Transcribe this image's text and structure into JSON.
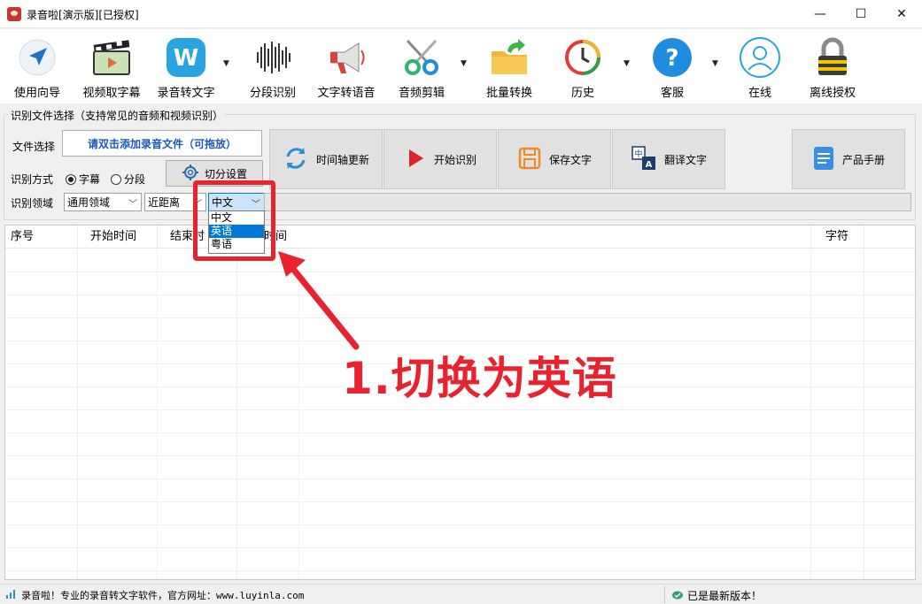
{
  "window": {
    "title": "录音啦[演示版][已授权]",
    "controls": {
      "minimize": "—",
      "maximize": "☐",
      "close": "✕"
    }
  },
  "toolbar": {
    "items": [
      {
        "label": "使用向导",
        "icon": "navigation-arrow-icon"
      },
      {
        "label": "视频取字幕",
        "icon": "video-clapper-icon"
      },
      {
        "label": "录音转文字",
        "icon": "w-app-icon",
        "has_dropdown": true
      },
      {
        "label": "分段识别",
        "icon": "sound-wave-icon"
      },
      {
        "label": "文字转语音",
        "icon": "megaphone-icon"
      },
      {
        "label": "音频剪辑",
        "icon": "scissors-icon",
        "has_dropdown": true
      },
      {
        "label": "批量转换",
        "icon": "folder-arrow-icon"
      },
      {
        "label": "历史",
        "icon": "history-clock-icon",
        "has_dropdown": true
      },
      {
        "label": "客服",
        "icon": "help-question-icon",
        "has_dropdown": true
      },
      {
        "label": "在线",
        "icon": "user-online-icon"
      },
      {
        "label": "离线授权",
        "icon": "lock-icon"
      }
    ]
  },
  "panel": {
    "group_title": "识别文件选择（支持常见的音频和视频识别）",
    "file_label": "文件选择",
    "add_file_button": "请双击添加录音文件（可拖放）",
    "mode_label": "识别方式",
    "mode_options": [
      {
        "label": "字幕",
        "checked": true
      },
      {
        "label": "分段",
        "checked": false
      }
    ],
    "split_settings_button": "切分设置",
    "domain_label": "识别领域",
    "domain_select": "通用领域",
    "distance_select": "近距离",
    "language_select": "中文",
    "language_options": [
      "中文",
      "英语",
      "粤语"
    ],
    "language_highlighted": "英语"
  },
  "actions": {
    "timeline_update": "时间轴更新",
    "start_recognition": "开始识别",
    "save_text": "保存文字",
    "translate_text": "翻译文字",
    "product_manual": "产品手册"
  },
  "table": {
    "columns": [
      "序号",
      "开始时间",
      "结束时",
      "时间",
      "字符"
    ]
  },
  "annotation": {
    "text": "1.切换为英语",
    "color": "#e8232d"
  },
  "status": {
    "left_text": "录音啦！专业的录音转文字软件，官方网址：www.luyinla.com",
    "right_text": "已是最新版本！"
  }
}
